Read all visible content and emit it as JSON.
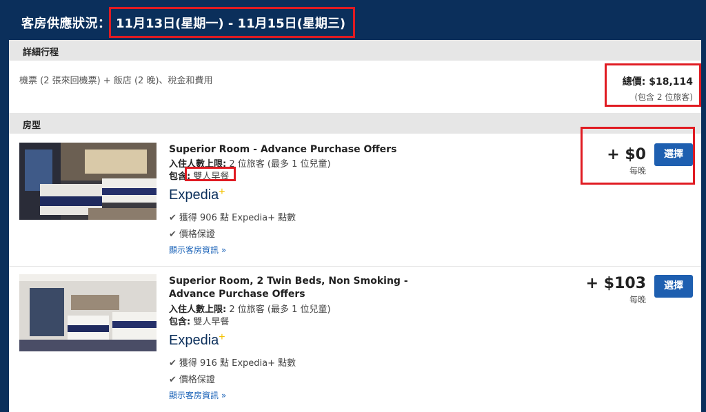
{
  "header": {
    "title": "客房供應狀況：",
    "dates": "11月13日(星期一) - 11月15日(星期三)"
  },
  "itinerary": {
    "section_label": "詳細行程",
    "description": "機票 (2 張來回機票) + 飯店 (2 晚)、稅金和費用",
    "total_label": "總價: $18,114",
    "total_note": "(包含 2 位旅客)"
  },
  "rooms_section": {
    "label": "房型"
  },
  "rooms": [
    {
      "name_line1": "Superior Room - Advance Purchase Offers",
      "name_line2": "",
      "occupancy_label": "入住人數上限:",
      "occupancy_value": "2 位旅客 (最多 1 位兒童)",
      "includes_label": "包含:",
      "includes_value": "雙人早餐",
      "brand": "Expedia",
      "points": "獲得 906 點 Expedia+ 點數",
      "guarantee": "價格保證",
      "details_link": "顯示客房資訊",
      "price": "+ $0",
      "per_night": "每晚",
      "select_label": "選擇"
    },
    {
      "name_line1": "Superior Room, 2 Twin Beds, Non Smoking -",
      "name_line2": "Advance Purchase Offers",
      "occupancy_label": "入住人數上限:",
      "occupancy_value": "2 位旅客 (最多 1 位兒童)",
      "includes_label": "包含:",
      "includes_value": "雙人早餐",
      "brand": "Expedia",
      "points": "獲得 916 點 Expedia+ 點數",
      "guarantee": "價格保證",
      "details_link": "顯示客房資訊",
      "price": "+ $103",
      "per_night": "每晚",
      "select_label": "選擇"
    }
  ],
  "icons": {
    "check": "check-icon",
    "chevron": "chevron-down-icon"
  },
  "colors": {
    "header_bg": "#0b2f5b",
    "button": "#1e5fb0",
    "highlight": "#e01b22",
    "link": "#1b63b8"
  }
}
